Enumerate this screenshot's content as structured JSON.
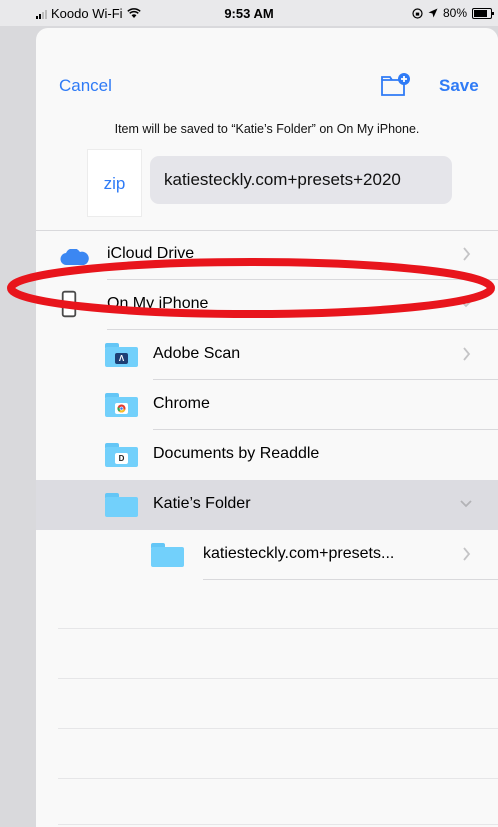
{
  "status_bar": {
    "carrier": "Koodo Wi-Fi",
    "time": "9:53 AM",
    "battery": "80%"
  },
  "nav": {
    "cancel_label": "Cancel",
    "save_label": "Save"
  },
  "save_info": "Item will be saved to “Katie’s Folder” on On My iPhone.",
  "file": {
    "type_label": "zip",
    "name": "katiesteckly.com+presets+2020"
  },
  "locations": [
    {
      "label": "iCloud Drive",
      "icon": "icloud-icon"
    },
    {
      "label": "On My iPhone",
      "icon": "iphone-icon"
    }
  ],
  "folders": [
    {
      "label": "Adobe Scan",
      "icon": "adobe-scan-folder-icon"
    },
    {
      "label": "Chrome",
      "icon": "chrome-folder-icon"
    },
    {
      "label": "Documents by Readdle",
      "icon": "readdle-folder-icon"
    },
    {
      "label": "Katie’s Folder",
      "icon": "folder-icon"
    },
    {
      "label": "katiesteckly.com+presets...",
      "icon": "folder-icon"
    }
  ],
  "colors": {
    "accent": "#2f7bf6",
    "folder": "#72d0fb",
    "selected_row": "#dcdce1",
    "annotation": "#e8151c"
  }
}
